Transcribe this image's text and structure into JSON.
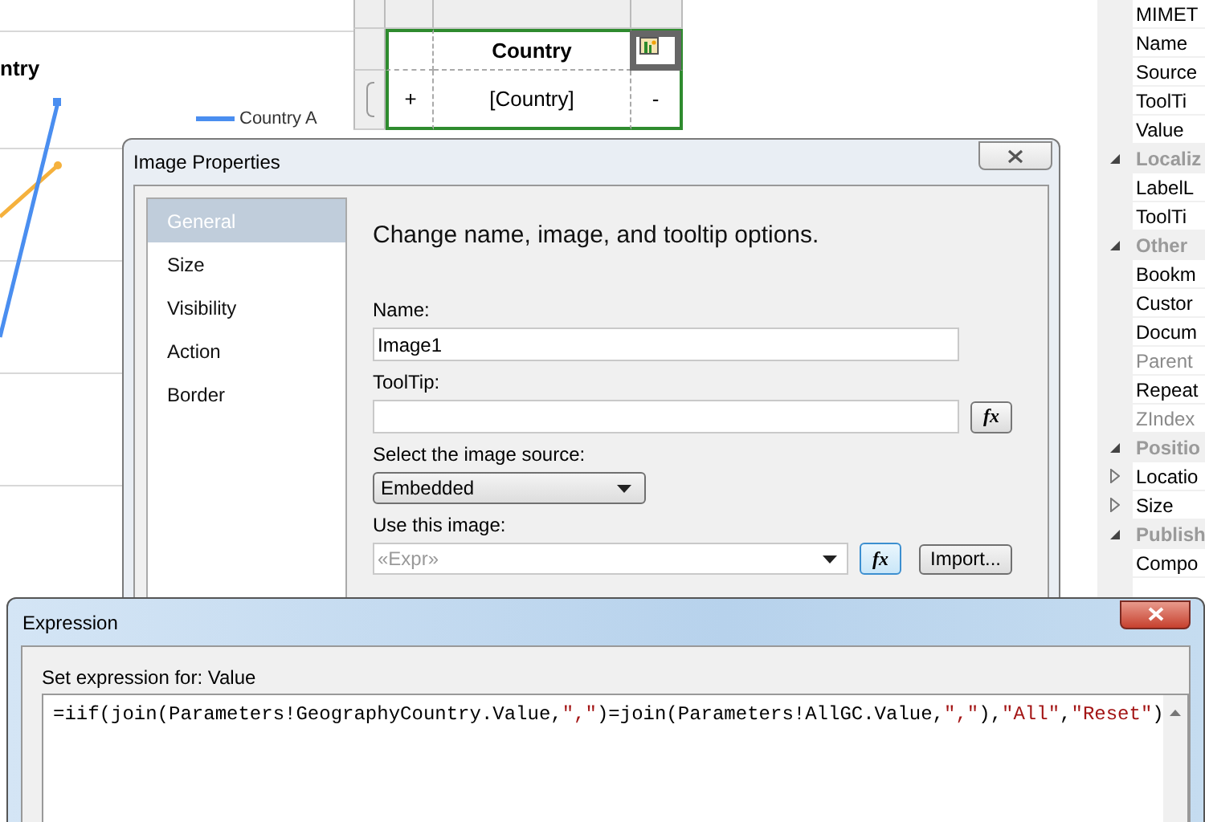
{
  "report": {
    "chart": {
      "title": "ntry",
      "legend": [
        {
          "label": "Country A",
          "color": "#4a8ef0"
        }
      ]
    },
    "table": {
      "header": "Country",
      "expand": "+",
      "field": "[Country]",
      "collapse": "-"
    }
  },
  "properties_panel": {
    "items": [
      {
        "label": "MIMET",
        "kind": "property",
        "disabled": false
      },
      {
        "label": "Name",
        "kind": "property",
        "disabled": false
      },
      {
        "label": "Source",
        "kind": "property",
        "disabled": false
      },
      {
        "label": "ToolTi",
        "kind": "property",
        "disabled": false
      },
      {
        "label": "Value",
        "kind": "property",
        "disabled": false
      },
      {
        "label": "Localiz",
        "kind": "category",
        "expanded": true
      },
      {
        "label": "LabelL",
        "kind": "property",
        "disabled": false
      },
      {
        "label": "ToolTi",
        "kind": "property",
        "disabled": false
      },
      {
        "label": "Other",
        "kind": "category",
        "expanded": true
      },
      {
        "label": "Bookm",
        "kind": "property",
        "disabled": false
      },
      {
        "label": "Custor",
        "kind": "property",
        "disabled": false
      },
      {
        "label": "Docum",
        "kind": "property",
        "disabled": false
      },
      {
        "label": "Parent",
        "kind": "property",
        "disabled": true
      },
      {
        "label": "Repeat",
        "kind": "property",
        "disabled": false
      },
      {
        "label": "ZIndex",
        "kind": "property",
        "disabled": true
      },
      {
        "label": "Positio",
        "kind": "category",
        "expanded": true
      },
      {
        "label": "Locatio",
        "kind": "property",
        "disabled": false,
        "expanded": false
      },
      {
        "label": "Size",
        "kind": "property",
        "disabled": false,
        "expanded": false
      },
      {
        "label": "Publish",
        "kind": "category",
        "expanded": true
      },
      {
        "label": "Compo",
        "kind": "property",
        "disabled": false
      }
    ]
  },
  "image_properties": {
    "title": "Image Properties",
    "nav": [
      {
        "label": "General",
        "selected": true
      },
      {
        "label": "Size",
        "selected": false
      },
      {
        "label": "Visibility",
        "selected": false
      },
      {
        "label": "Action",
        "selected": false
      },
      {
        "label": "Border",
        "selected": false
      }
    ],
    "heading": "Change name, image, and tooltip options.",
    "name": {
      "label": "Name:",
      "value": "Image1"
    },
    "tooltip": {
      "label": "ToolTip:",
      "button": {
        "label": "fx",
        "focused": false
      }
    },
    "source": {
      "label": "Select the image source:",
      "value": "Embedded"
    },
    "image": {
      "label": "Use this image:",
      "placeholder": "«Expr»",
      "button": {
        "label": "fx",
        "focused": true
      },
      "import": "Import..."
    }
  },
  "expression": {
    "title": "Expression",
    "label": "Set expression for: Value",
    "tokens": [
      {
        "kind": "code",
        "text": "=iif(join(Parameters!GeographyCountry.Value,"
      },
      {
        "kind": "string",
        "text": "\",\""
      },
      {
        "kind": "code",
        "text": ")=join(Parameters!AllGC.Value,"
      },
      {
        "kind": "string",
        "text": "\",\""
      },
      {
        "kind": "code",
        "text": "),"
      },
      {
        "kind": "string",
        "text": "\"All\""
      },
      {
        "kind": "code",
        "text": ","
      },
      {
        "kind": "string",
        "text": "\"Reset\""
      },
      {
        "kind": "code",
        "text": ")"
      }
    ]
  }
}
